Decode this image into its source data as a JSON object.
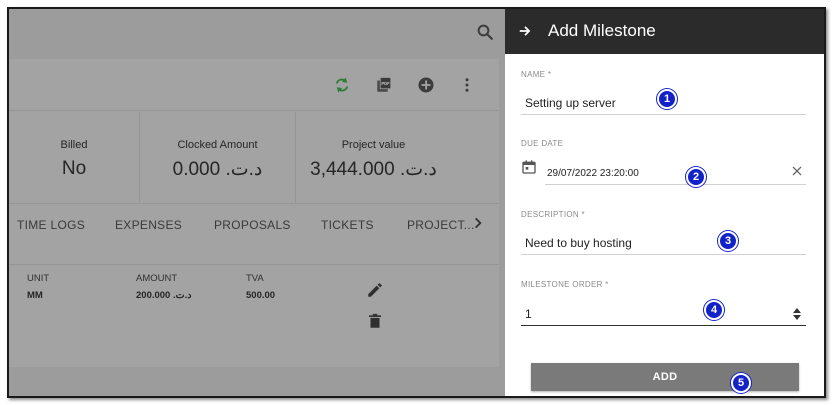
{
  "drawer": {
    "title": "Add Milestone",
    "fields": {
      "name": {
        "label": "NAME *",
        "value": "Setting up server"
      },
      "due_date": {
        "label": "DUE DATE",
        "value": "29/07/2022 23:20:00"
      },
      "description": {
        "label": "DESCRIPTION *",
        "value": "Need to buy hosting"
      },
      "milestone_order": {
        "label": "MILESTONE ORDER *",
        "value": "1"
      }
    },
    "add_button": "ADD",
    "badges": [
      "1",
      "2",
      "3",
      "4",
      "5"
    ]
  },
  "background": {
    "stats": [
      {
        "label": "Billed",
        "value": "No"
      },
      {
        "label": "Clocked Amount",
        "value": "د.ت. 0.000"
      },
      {
        "label": "Project value",
        "value": "د.ت. 3,444.000"
      }
    ],
    "tabs": [
      "TIME LOGS",
      "EXPENSES",
      "PROPOSALS",
      "TICKETS",
      "PROJECT..."
    ],
    "table": {
      "headers": [
        "UNIT",
        "AMOUNT",
        "TVA"
      ],
      "row": [
        "MM",
        "د.ت. 200.000",
        "500.00"
      ]
    },
    "icons": {
      "search": "search-icon",
      "refresh": "refresh-icon",
      "pdf": "pdf-icon",
      "add": "add-circle-icon",
      "more": "more-vert-icon",
      "edit": "edit-icon",
      "delete": "delete-icon"
    }
  },
  "colors": {
    "header_bg": "#2b2b2b",
    "badge": "#1321c9",
    "refresh_green": "#2e7d32",
    "overlay": "#9c9c9c"
  }
}
